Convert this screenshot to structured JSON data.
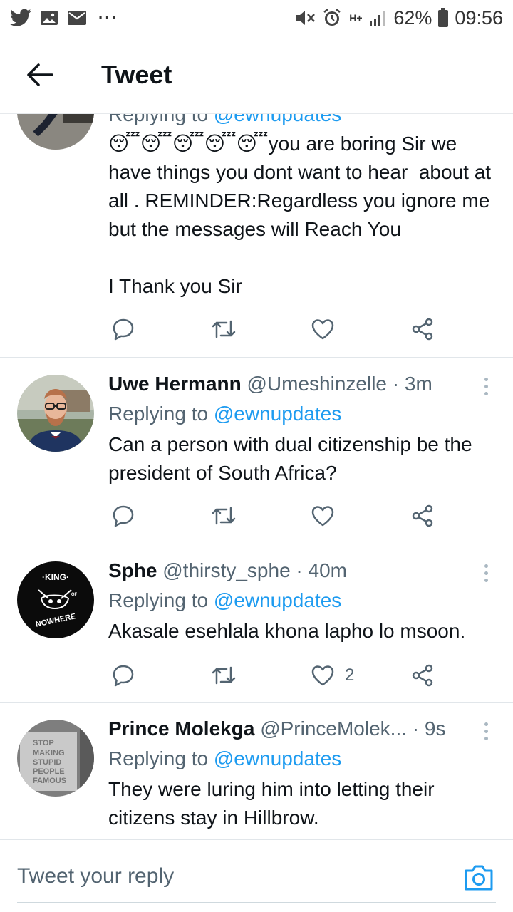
{
  "status_bar": {
    "battery": "62%",
    "time": "09:56",
    "network": "H+",
    "icons": [
      "twitter-icon",
      "gallery-icon",
      "mail-icon",
      "mute-icon",
      "alarm-icon",
      "signal-icon",
      "battery-icon"
    ]
  },
  "header": {
    "title": "Tweet"
  },
  "tweets": [
    {
      "reply_prefix": "Replying to ",
      "reply_handle": "@ewnupdates",
      "emoji": "😴😴😴😴😴",
      "text": "you are boring Sir we have things you dont want to hear  about at all . REMINDER:Regardless you ignore me but the messages will Reach You\n\nI Thank you Sir"
    },
    {
      "name": "Uwe Hermann",
      "handle": "@Umeshinzelle",
      "time": "· 3m",
      "reply_prefix": "Replying to ",
      "reply_handle": "@ewnupdates",
      "text": "Can a person with dual citizenship be the president of South Africa?"
    },
    {
      "name": "Sphe",
      "handle": "@thirsty_sphe",
      "time": "· 40m",
      "reply_prefix": "Replying to ",
      "reply_handle": "@ewnupdates",
      "text": "Akasale esehlala khona lapho lo msoon.",
      "like_count": "2",
      "avatar_text_top": "·KING·",
      "avatar_text_mid": "OF",
      "avatar_text_bottom": "NOWHERE"
    },
    {
      "name": "Prince Molekga",
      "handle": "@PrinceMolek...",
      "time": "· 9s",
      "reply_prefix": "Replying to ",
      "reply_handle": "@ewnupdates",
      "text": "They were luring him into letting their citizens stay in Hillbrow.",
      "avatar_sign": "STOP\nMAKING\nSTUPID\nPEOPLE\nFAMOUS"
    }
  ],
  "reply_bar": {
    "placeholder": "Tweet your reply"
  },
  "colors": {
    "accent": "#1d9bf0",
    "muted": "#536471",
    "text": "#0f1419"
  }
}
